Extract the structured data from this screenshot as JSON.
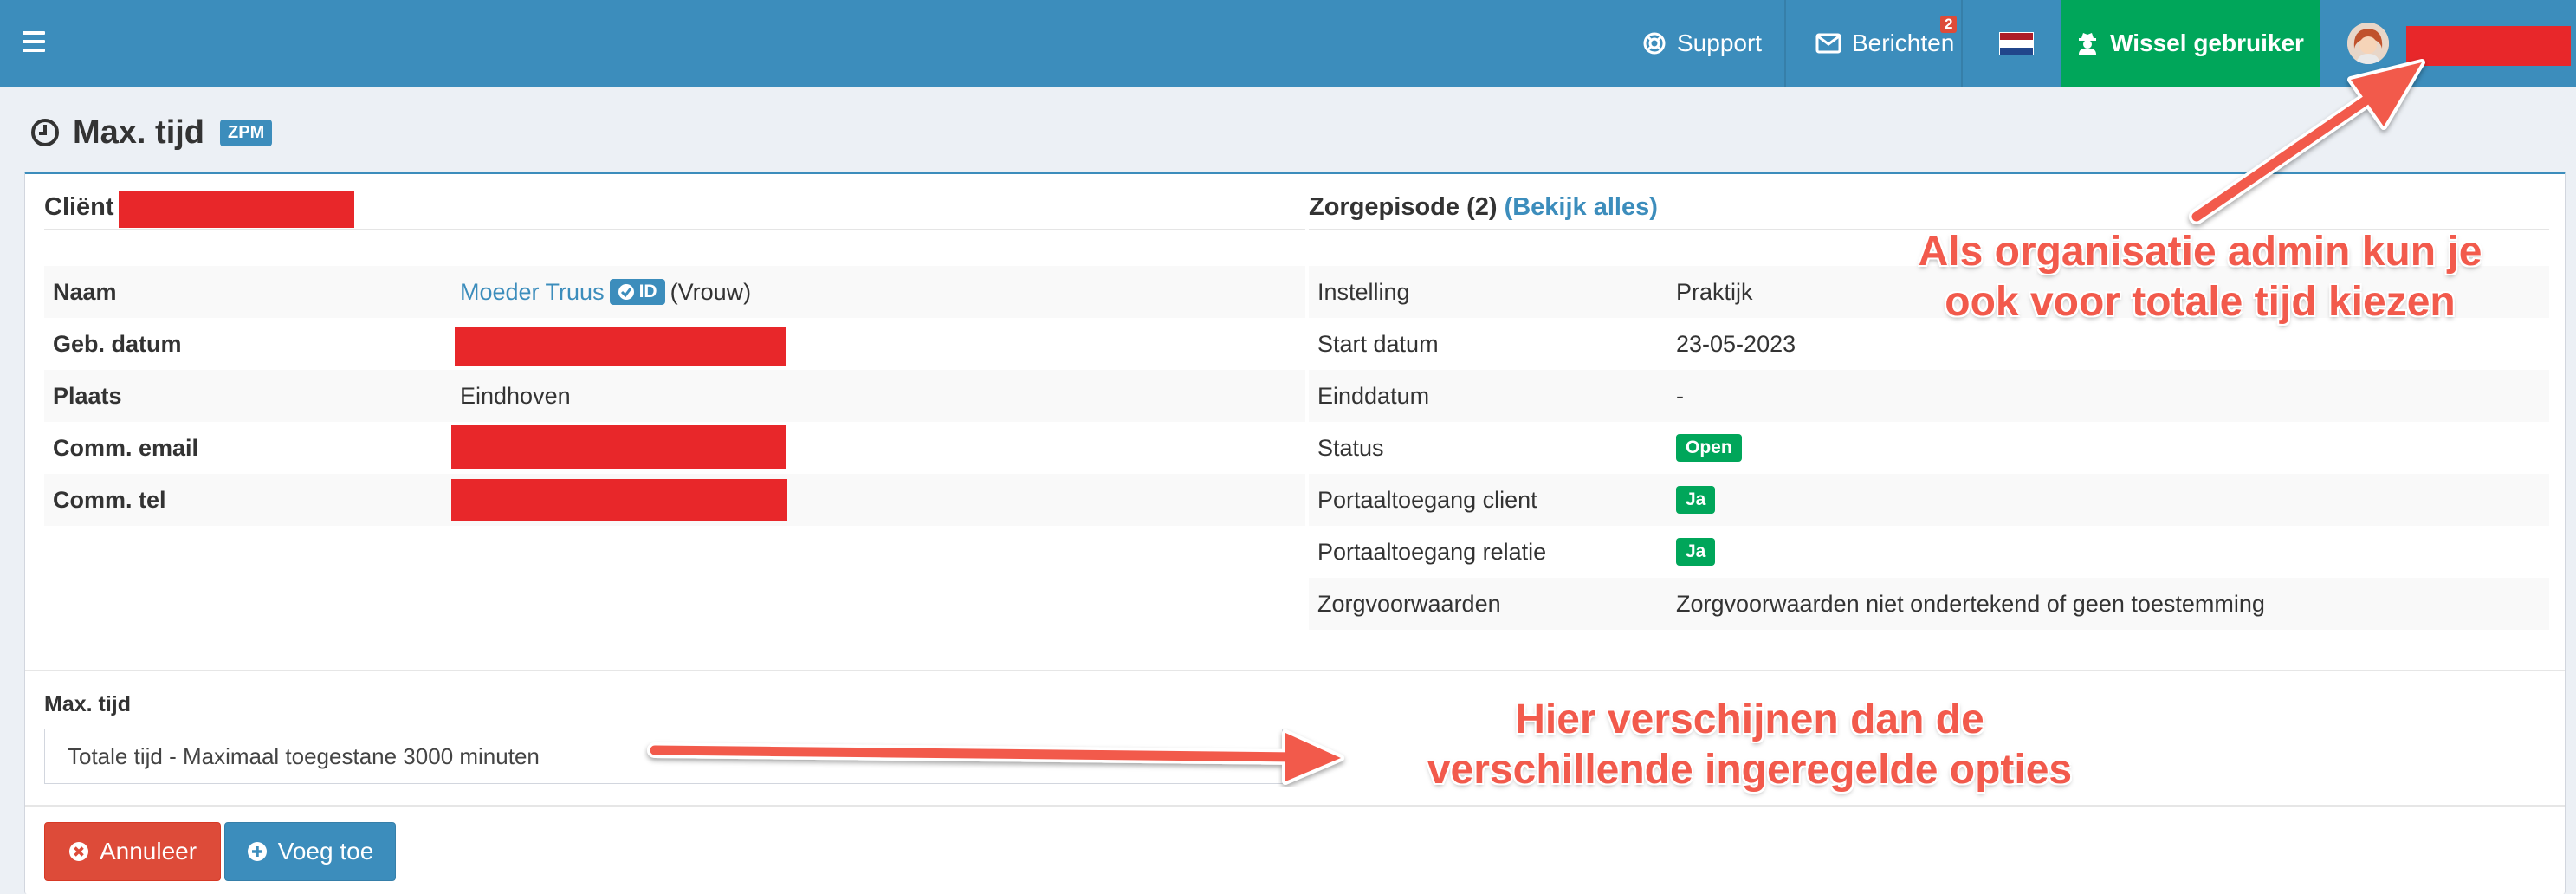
{
  "navbar": {
    "support_label": "Support",
    "messages_label": "Berichten",
    "messages_count": "2",
    "switch_user_label": "Wissel gebruiker",
    "flag_colors": [
      "#ae1c28",
      "#ffffff",
      "#21468b"
    ]
  },
  "page": {
    "title": "Max. tijd",
    "badge": "ZPM"
  },
  "client": {
    "title": "Cliënt",
    "rows": [
      {
        "key": "Naam",
        "name_link": "Moeder Truus",
        "id_badge": "ID",
        "suffix": "(Vrouw)"
      },
      {
        "key": "Geb. datum"
      },
      {
        "key": "Plaats",
        "value": "Eindhoven"
      },
      {
        "key": "Comm. email"
      },
      {
        "key": "Comm. tel"
      }
    ]
  },
  "episode": {
    "title": "Zorgepisode (2)",
    "link": "(Bekijk alles)",
    "rows": [
      {
        "key": "Instelling",
        "value": "Praktijk"
      },
      {
        "key": "Start datum",
        "value": "23-05-2023"
      },
      {
        "key": "Einddatum",
        "value": "-"
      },
      {
        "key": "Status",
        "badge": "Open"
      },
      {
        "key": "Portaaltoegang client",
        "badge": "Ja"
      },
      {
        "key": "Portaaltoegang relatie",
        "badge": "Ja"
      },
      {
        "key": "Zorgvoorwaarden",
        "value": "Zorgvoorwaarden niet ondertekend of geen toestemming"
      }
    ]
  },
  "form": {
    "label": "Max. tijd",
    "selected": "Totale tijd - Maximaal toegestane 3000 minuten"
  },
  "buttons": {
    "cancel": "Annuleer",
    "add": "Voeg toe"
  },
  "annotations": {
    "top_line1": "Als organisatie admin kun je",
    "top_line2": "ook voor totale tijd kiezen",
    "bottom_line1": "Hier verschijnen dan de",
    "bottom_line2": "verschillende ingeregelde opties"
  },
  "colors": {
    "navbar": "#3c8dbc",
    "success": "#00a65a",
    "danger": "#dd4b39",
    "redaction": "#e8272a",
    "annotation": "#f25a4c"
  }
}
